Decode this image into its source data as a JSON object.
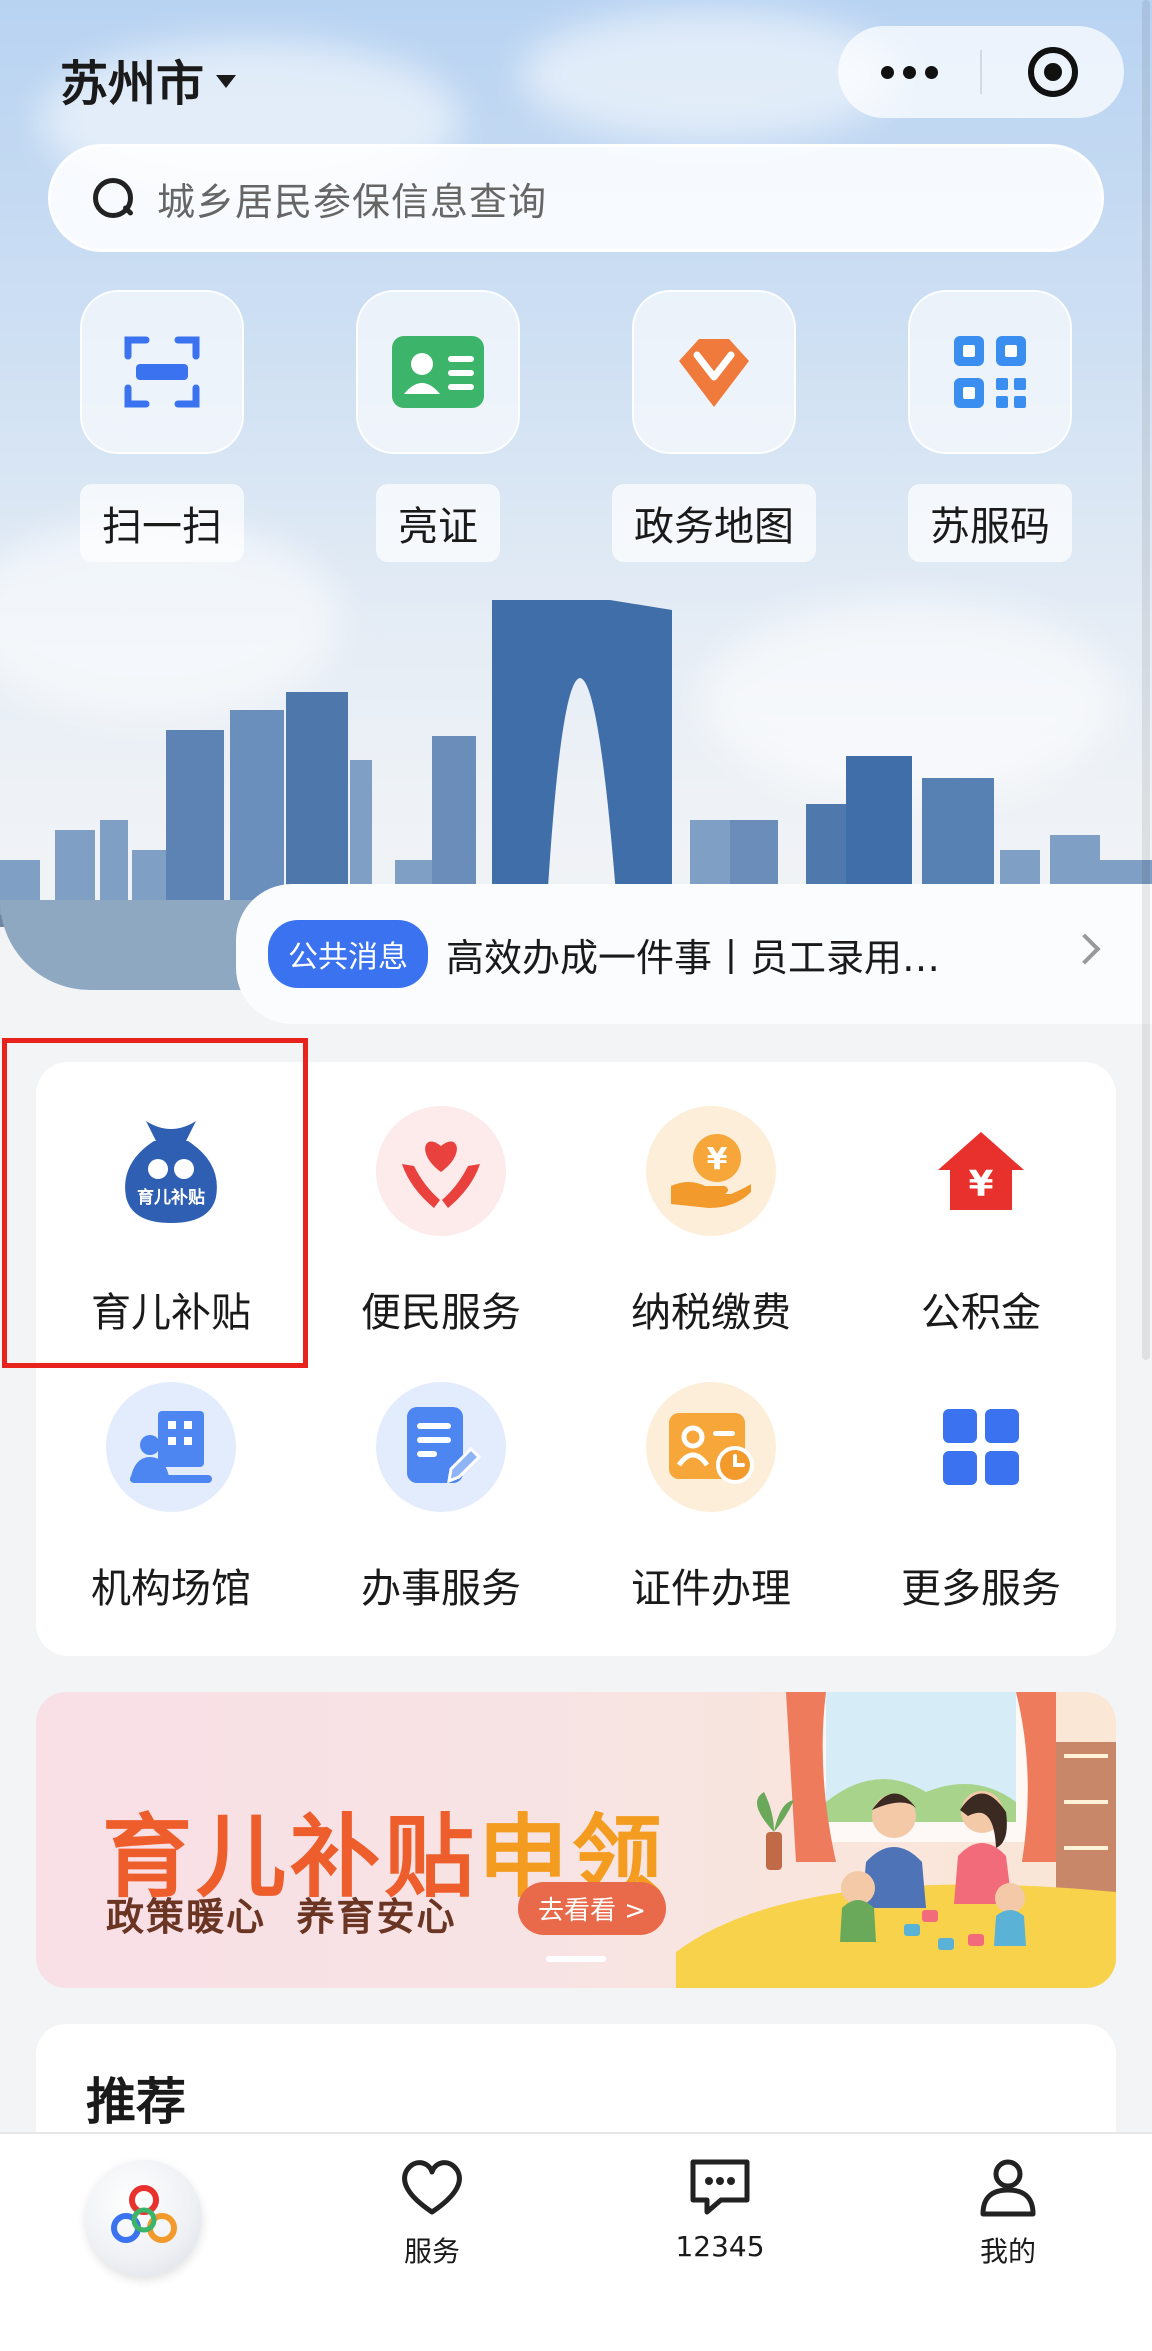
{
  "header": {
    "city": "苏州市"
  },
  "search": {
    "placeholder": "城乡居民参保信息查询"
  },
  "quick_actions": [
    {
      "label": "扫一扫",
      "icon": "scan-icon"
    },
    {
      "label": "亮证",
      "icon": "id-card-icon"
    },
    {
      "label": "政务地图",
      "icon": "map-icon"
    },
    {
      "label": "苏服码",
      "icon": "qr-code-icon"
    }
  ],
  "notice": {
    "badge": "公共消息",
    "text": "高效办成一件事丨员工录用…"
  },
  "services": [
    {
      "label": "育儿补贴",
      "icon": "childcare-subsidy-icon",
      "badge_text": "育儿补贴"
    },
    {
      "label": "便民服务",
      "icon": "heart-hands-icon"
    },
    {
      "label": "纳税缴费",
      "icon": "tax-payment-icon",
      "glyph": "¥"
    },
    {
      "label": "公积金",
      "icon": "housing-fund-icon",
      "glyph": "¥"
    },
    {
      "label": "机构场馆",
      "icon": "building-icon"
    },
    {
      "label": "办事服务",
      "icon": "document-edit-icon"
    },
    {
      "label": "证件办理",
      "icon": "certificate-icon"
    },
    {
      "label": "更多服务",
      "icon": "more-grid-icon"
    }
  ],
  "banner": {
    "title_part1": "育儿补贴",
    "title_part2": "申领",
    "subtitle": "政策暖心  养育安心",
    "button": "去看看 >"
  },
  "recommend": {
    "title": "推荐"
  },
  "tabbar": [
    {
      "label": "",
      "icon": "app-logo-icon"
    },
    {
      "label": "服务",
      "icon": "heart-icon"
    },
    {
      "label": "12345",
      "icon": "message-icon"
    },
    {
      "label": "我的",
      "icon": "user-icon"
    }
  ],
  "colors": {
    "accent": "#3a72ef",
    "highlight_border": "#e8221c",
    "banner_orange": "#ee5e2c"
  }
}
